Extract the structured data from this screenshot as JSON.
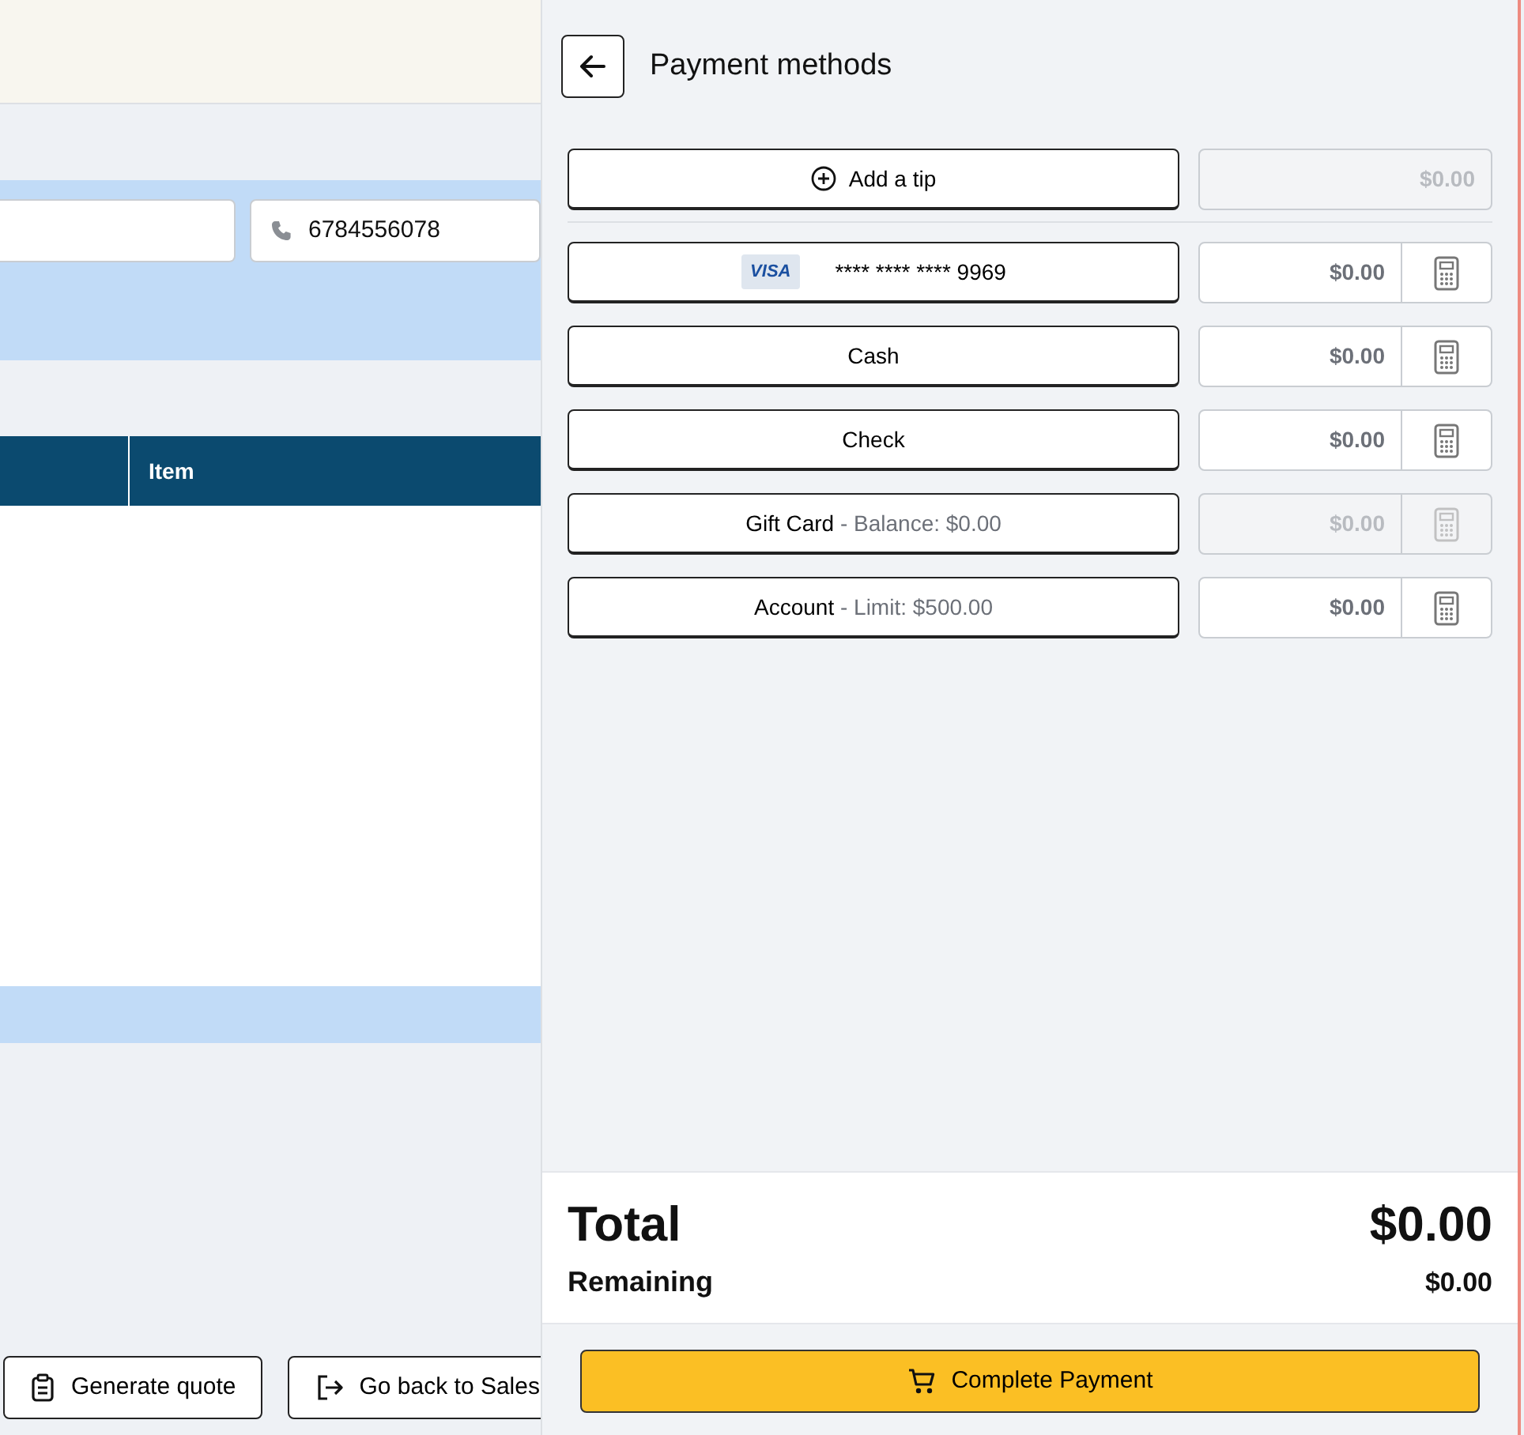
{
  "background": {
    "fields": [
      {
        "kind": "text"
      },
      {
        "kind": "phone",
        "value": "6784556078"
      }
    ],
    "table": {
      "columns": [
        "Item"
      ]
    },
    "buttons": [
      {
        "label": "Generate quote"
      },
      {
        "label": "Go back to Sales"
      }
    ]
  },
  "panel": {
    "title": "Payment methods",
    "tip": {
      "label": "Add a tip",
      "amount": "$0.00",
      "disabled": true
    },
    "methods": [
      {
        "kind": "card",
        "brand": "VISA",
        "label": "**** **** **** 9969",
        "amount": "$0.00",
        "disabled": false
      },
      {
        "kind": "plain",
        "label": "Cash",
        "amount": "$0.00",
        "disabled": false
      },
      {
        "kind": "plain",
        "label": "Check",
        "amount": "$0.00",
        "disabled": false
      },
      {
        "kind": "plain",
        "label": "Gift Card",
        "detail": "- Balance: $0.00",
        "amount": "$0.00",
        "disabled": true
      },
      {
        "kind": "plain",
        "label": "Account",
        "detail": "- Limit: $500.00",
        "amount": "$0.00",
        "disabled": false
      }
    ],
    "total": {
      "label": "Total",
      "value": "$0.00"
    },
    "remaining": {
      "label": "Remaining",
      "value": "$0.00"
    },
    "complete_button": "Complete Payment"
  }
}
